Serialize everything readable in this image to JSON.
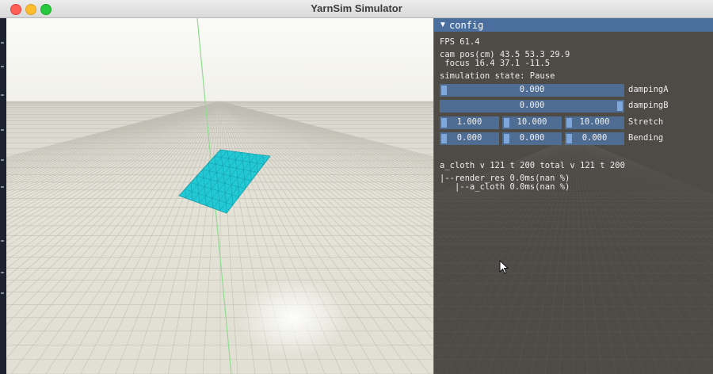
{
  "window": {
    "title": "YarnSim Simulator"
  },
  "panel": {
    "header": "config",
    "fps": "FPS 61.4",
    "cam_pos": "cam pos(cm) 43.5 53.3 29.9",
    "focus": " focus 16.4 37.1 -11.5",
    "sim_state": "simulation state: Pause",
    "rows": [
      {
        "label": "dampingA",
        "values": [
          "0.000"
        ]
      },
      {
        "label": "dampingB",
        "values": [
          "0.000"
        ]
      },
      {
        "label": "Stretch",
        "values": [
          "1.000",
          "10.000",
          "10.000"
        ]
      },
      {
        "label": "Bending",
        "values": [
          "0.000",
          "0.000",
          "0.000"
        ]
      }
    ],
    "stats": "a_cloth v 121 t 200 total v 121 t 200",
    "profile1": "|--render_res 0.0ms(nan %)",
    "profile2": "   |--a_cloth 0.0ms(nan %)"
  },
  "colors": {
    "accent": "#4a6f9f",
    "slider_bg": "#4f6d93",
    "slider_grab": "#7fa7dc",
    "cloth": "#22c8d4",
    "panel_bg": "#4e4b47"
  },
  "icons": [
    "close-button",
    "minimize-button",
    "zoom-button",
    "collapse-arrow-icon",
    "mouse-pointer-icon"
  ]
}
